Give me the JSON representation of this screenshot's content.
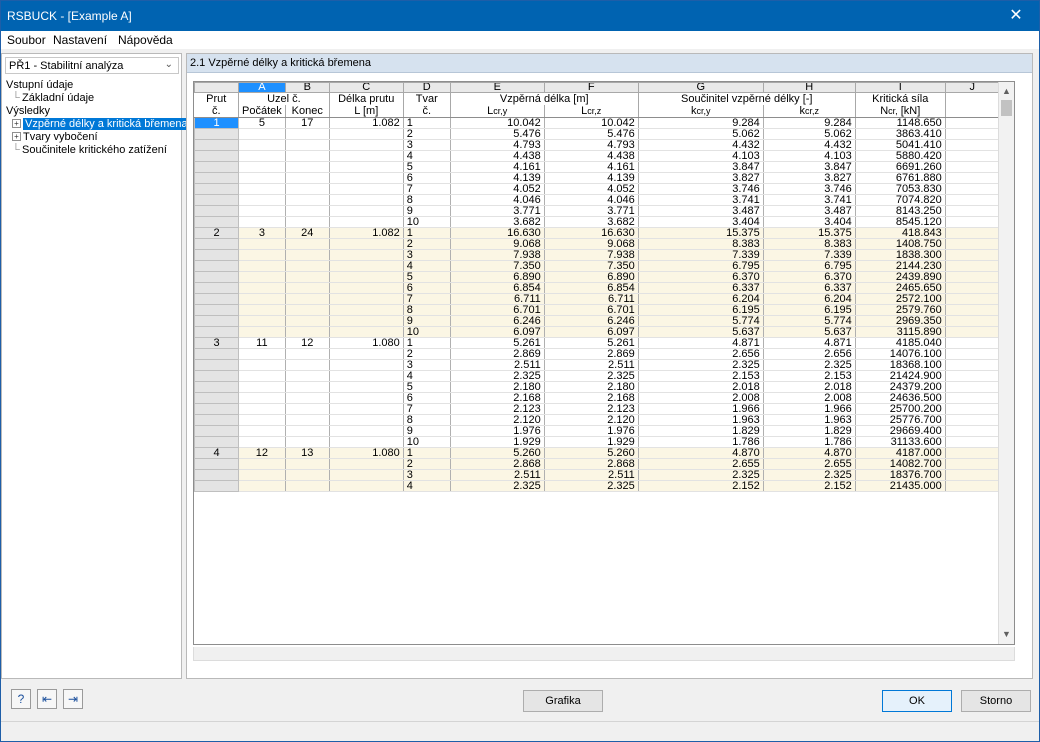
{
  "window": {
    "title": "RSBUCK - [Example A]",
    "close_glyph": "✕"
  },
  "menu": [
    "Soubor",
    "Nastavení",
    "Nápověda"
  ],
  "left": {
    "dropdown": "PŘ1 - Stabilitní analýza",
    "tree": [
      {
        "label": "Vstupní údaje",
        "expander": ""
      },
      {
        "label": "Základní údaje",
        "expander": ""
      },
      {
        "label": "Výsledky",
        "expander": ""
      },
      {
        "label": "Vzpěrné délky a kritická břemena",
        "expander": "+",
        "selected": true
      },
      {
        "label": "Tvary vybočení",
        "expander": "+"
      },
      {
        "label": "Součinitele kritického zatížení",
        "expander": ""
      }
    ]
  },
  "panel_title": "2.1 Vzpěrné délky a kritická břemena",
  "table": {
    "col_letters": [
      "A",
      "B",
      "C",
      "D",
      "E",
      "F",
      "G",
      "H",
      "I",
      "J"
    ],
    "header": {
      "prut": "Prut",
      "prut_c": "č.",
      "uzel": "Uzel č.",
      "pocatek": "Počátek",
      "konec": "Konec",
      "delka": "Délka prutu",
      "delka_unit": "L [m]",
      "tvar": "Tvar",
      "tvar_c": "č.",
      "vzperna": "Vzpěrná délka [m]",
      "lcry": "L",
      "lcry_sub": "cr,y",
      "lcrz": "L",
      "lcrz_sub": "cr,z",
      "souc": "Součinitel vzpěrné délky [-]",
      "kcry": "k",
      "kcry_sub": "cr,y",
      "kcrz": "k",
      "kcrz_sub": "cr,z",
      "krit": "Kritická síla",
      "ncr": "N",
      "ncr_sub": "cr,",
      "ncr_unit": " [kN]"
    },
    "groups": [
      {
        "prut": "1",
        "start": "5",
        "end": "17",
        "length": "1.082",
        "rows": [
          [
            "1",
            "10.042",
            "10.042",
            "9.284",
            "9.284",
            "1148.650"
          ],
          [
            "2",
            "5.476",
            "5.476",
            "5.062",
            "5.062",
            "3863.410"
          ],
          [
            "3",
            "4.793",
            "4.793",
            "4.432",
            "4.432",
            "5041.410"
          ],
          [
            "4",
            "4.438",
            "4.438",
            "4.103",
            "4.103",
            "5880.420"
          ],
          [
            "5",
            "4.161",
            "4.161",
            "3.847",
            "3.847",
            "6691.260"
          ],
          [
            "6",
            "4.139",
            "4.139",
            "3.827",
            "3.827",
            "6761.880"
          ],
          [
            "7",
            "4.052",
            "4.052",
            "3.746",
            "3.746",
            "7053.830"
          ],
          [
            "8",
            "4.046",
            "4.046",
            "3.741",
            "3.741",
            "7074.820"
          ],
          [
            "9",
            "3.771",
            "3.771",
            "3.487",
            "3.487",
            "8143.250"
          ],
          [
            "10",
            "3.682",
            "3.682",
            "3.404",
            "3.404",
            "8545.120"
          ]
        ]
      },
      {
        "prut": "2",
        "start": "3",
        "end": "24",
        "length": "1.082",
        "rows": [
          [
            "1",
            "16.630",
            "16.630",
            "15.375",
            "15.375",
            "418.843"
          ],
          [
            "2",
            "9.068",
            "9.068",
            "8.383",
            "8.383",
            "1408.750"
          ],
          [
            "3",
            "7.938",
            "7.938",
            "7.339",
            "7.339",
            "1838.300"
          ],
          [
            "4",
            "7.350",
            "7.350",
            "6.795",
            "6.795",
            "2144.230"
          ],
          [
            "5",
            "6.890",
            "6.890",
            "6.370",
            "6.370",
            "2439.890"
          ],
          [
            "6",
            "6.854",
            "6.854",
            "6.337",
            "6.337",
            "2465.650"
          ],
          [
            "7",
            "6.711",
            "6.711",
            "6.204",
            "6.204",
            "2572.100"
          ],
          [
            "8",
            "6.701",
            "6.701",
            "6.195",
            "6.195",
            "2579.760"
          ],
          [
            "9",
            "6.246",
            "6.246",
            "5.774",
            "5.774",
            "2969.350"
          ],
          [
            "10",
            "6.097",
            "6.097",
            "5.637",
            "5.637",
            "3115.890"
          ]
        ]
      },
      {
        "prut": "3",
        "start": "11",
        "end": "12",
        "length": "1.080",
        "rows": [
          [
            "1",
            "5.261",
            "5.261",
            "4.871",
            "4.871",
            "4185.040"
          ],
          [
            "2",
            "2.869",
            "2.869",
            "2.656",
            "2.656",
            "14076.100"
          ],
          [
            "3",
            "2.511",
            "2.511",
            "2.325",
            "2.325",
            "18368.100"
          ],
          [
            "4",
            "2.325",
            "2.325",
            "2.153",
            "2.153",
            "21424.900"
          ],
          [
            "5",
            "2.180",
            "2.180",
            "2.018",
            "2.018",
            "24379.200"
          ],
          [
            "6",
            "2.168",
            "2.168",
            "2.008",
            "2.008",
            "24636.500"
          ],
          [
            "7",
            "2.123",
            "2.123",
            "1.966",
            "1.966",
            "25700.200"
          ],
          [
            "8",
            "2.120",
            "2.120",
            "1.963",
            "1.963",
            "25776.700"
          ],
          [
            "9",
            "1.976",
            "1.976",
            "1.829",
            "1.829",
            "29669.400"
          ],
          [
            "10",
            "1.929",
            "1.929",
            "1.786",
            "1.786",
            "31133.600"
          ]
        ]
      },
      {
        "prut": "4",
        "start": "12",
        "end": "13",
        "length": "1.080",
        "rows": [
          [
            "1",
            "5.260",
            "5.260",
            "4.870",
            "4.870",
            "4187.000"
          ],
          [
            "2",
            "2.868",
            "2.868",
            "2.655",
            "2.655",
            "14082.700"
          ],
          [
            "3",
            "2.511",
            "2.511",
            "2.325",
            "2.325",
            "18376.700"
          ],
          [
            "4",
            "2.325",
            "2.325",
            "2.152",
            "2.152",
            "21435.000"
          ]
        ]
      }
    ]
  },
  "buttons": {
    "grafika": "Grafika",
    "ok": "OK",
    "storno": "Storno"
  },
  "icons": {
    "help": "help-icon",
    "prev": "previous-table-icon",
    "next": "next-table-icon"
  },
  "colors": {
    "titlebar": "#0063b1",
    "selection": "#1e90ff",
    "row_alt": "#fbf6e4",
    "panel_header": "#d6e2ef"
  }
}
